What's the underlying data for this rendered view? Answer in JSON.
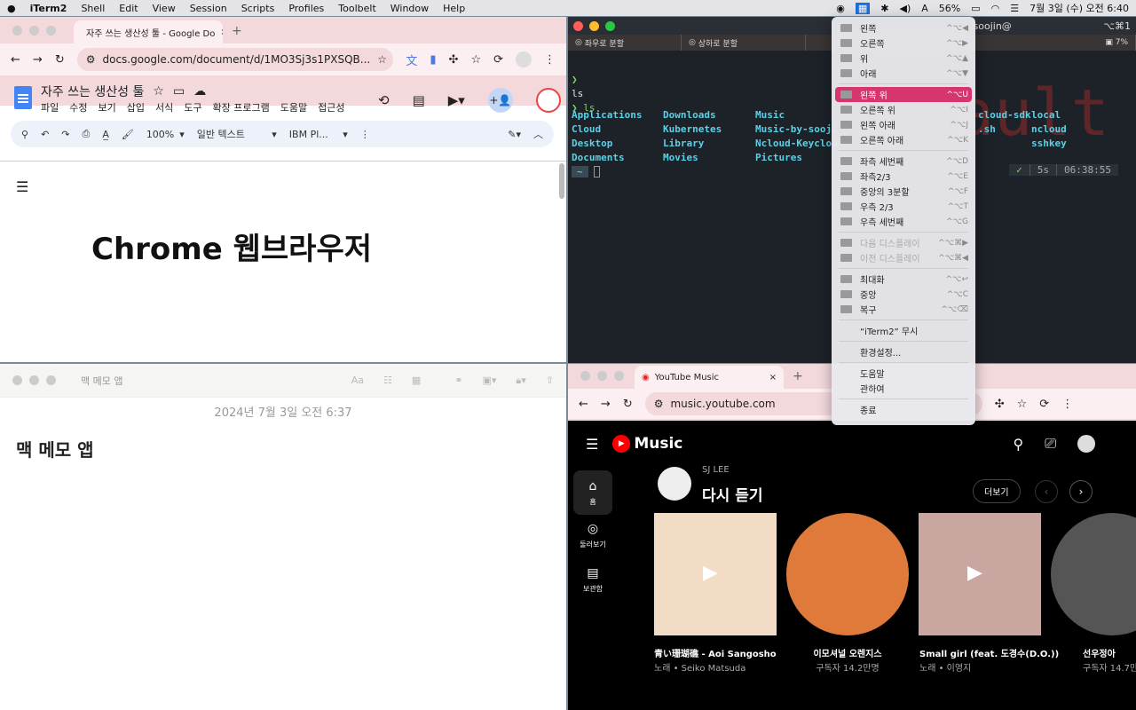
{
  "menubar": {
    "app": "iTerm2",
    "items": [
      "Shell",
      "Edit",
      "View",
      "Session",
      "Scripts",
      "Profiles",
      "Toolbelt",
      "Window",
      "Help"
    ],
    "battery": "56%",
    "datetime": "7월 3일 (수) 오전 6:40"
  },
  "gdoc": {
    "tab_title": "자주 쓰는 생산성 툴 - Google Do",
    "url": "docs.google.com/document/d/1MO3Sj3s1PXSQB...",
    "doc_title": "자주 쓰는 생산성 툴",
    "menus": [
      "파일",
      "수정",
      "보기",
      "삽입",
      "서식",
      "도구",
      "확장 프로그램",
      "도움말",
      "접근성"
    ],
    "zoom": "100%",
    "style": "일반 텍스트",
    "font": "IBM Pl...",
    "heading": "Chrome 웹브라우저"
  },
  "iterm": {
    "title": "soojin@",
    "tabs": [
      "좌우로 분할",
      "상하로 분할"
    ],
    "cpu": "7%",
    "right_hint": "⌥⌘1",
    "prompt1": "❯",
    "cmd1": "ls",
    "prompt2": "❯ ls",
    "ls_cols": [
      [
        "Applications",
        "Cloud",
        "Desktop",
        "Documents"
      ],
      [
        "Downloads",
        "Kubernetes",
        "Library",
        "Movies"
      ],
      [
        "Music",
        "Music-by-sooji",
        "Ncloud-Keycloa",
        "Pictures"
      ]
    ],
    "ls_extra": [
      "cloud-sdk",
      "local",
      ".sh",
      "ncloud",
      "sshkey"
    ],
    "ghost": "ault",
    "status_check": "✓",
    "status_dur": "5s",
    "status_time": "06:38:55",
    "cwd": "~"
  },
  "notes": {
    "title": "맥 메모 앱",
    "date": "2024년 7월 3일 오전 6:37",
    "body": "맥 메모 앱"
  },
  "ytm": {
    "tab_title": "YouTube Music",
    "url": "music.youtube.com",
    "logo": "Music",
    "nav": [
      "홈",
      "둘러보기",
      "보관함"
    ],
    "user": "SJ LEE",
    "section": "다시 듣기",
    "more": "더보기",
    "cards": [
      {
        "title": "青い珊瑚礁 - Aoi Sangosho",
        "sub": "노래 • Seiko Matsuda"
      },
      {
        "title": "이모셔널 오렌지스",
        "sub": "구독자 14.2만명"
      },
      {
        "title": "Small girl (feat. 도경수(D.O.))",
        "sub": "노래 • 이영지"
      },
      {
        "title": "선우정아",
        "sub": "구독자 14.7만"
      }
    ]
  },
  "menu": {
    "items": [
      {
        "label": "왼쪽",
        "sc": "^⌥◀"
      },
      {
        "label": "오른쪽",
        "sc": "^⌥▶"
      },
      {
        "label": "위",
        "sc": "^⌥▲"
      },
      {
        "label": "아래",
        "sc": "^⌥▼"
      },
      {
        "label": "왼쪽 위",
        "sc": "^⌥U"
      },
      {
        "label": "오른쪽 위",
        "sc": "^⌥I"
      },
      {
        "label": "왼쪽 아래",
        "sc": "^⌥J"
      },
      {
        "label": "오른쪽 아래",
        "sc": "^⌥K"
      },
      {
        "label": "좌측 세번째",
        "sc": "^⌥D"
      },
      {
        "label": "좌측2/3",
        "sc": "^⌥E"
      },
      {
        "label": "중앙의 3분할",
        "sc": "^⌥F"
      },
      {
        "label": "우측 2/3",
        "sc": "^⌥T"
      },
      {
        "label": "우측 세번째",
        "sc": "^⌥G"
      },
      {
        "label": "다음 디스플레이",
        "sc": "^⌥⌘▶"
      },
      {
        "label": "이전 디스플레이",
        "sc": "^⌥⌘◀"
      },
      {
        "label": "최대화",
        "sc": "^⌥↩"
      },
      {
        "label": "중앙",
        "sc": "^⌥C"
      },
      {
        "label": "복구",
        "sc": "^⌥⌫"
      },
      {
        "label": "“iTerm2” 무시"
      },
      {
        "label": "환경설정..."
      },
      {
        "label": "도움말"
      },
      {
        "label": "관하여"
      },
      {
        "label": "종료"
      }
    ]
  },
  "colors": {
    "highlight": "#d7356f",
    "chrome_pink": "#f3d8dc",
    "terminal_bg": "#1d2128"
  }
}
